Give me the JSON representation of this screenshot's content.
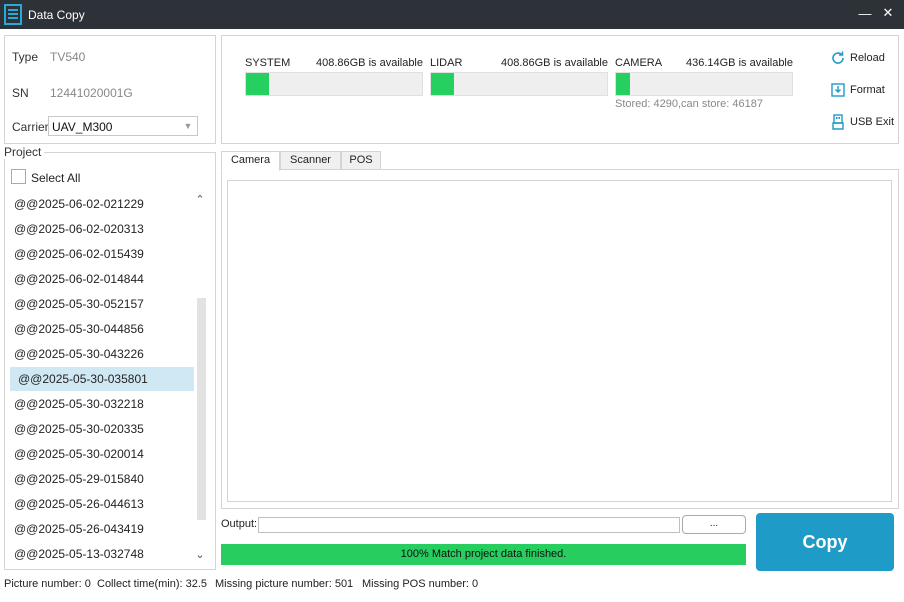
{
  "window": {
    "title": "Data Copy",
    "minimize": "—",
    "close": "✕"
  },
  "device": {
    "type_label": "Type",
    "type_value": "TV540",
    "sn_label": "SN",
    "sn_value": "12441020001G",
    "carrier_label": "Carrier",
    "carrier_value": "UAV_M300"
  },
  "project": {
    "legend": "Project",
    "select_all_label": "Select All",
    "selected_index": 7,
    "items": [
      "@@2025-06-02-021229",
      "@@2025-06-02-020313",
      "@@2025-06-02-015439",
      "@@2025-06-02-014844",
      "@@2025-05-30-052157",
      "@@2025-05-30-044856",
      "@@2025-05-30-043226",
      "@@2025-05-30-035801",
      "@@2025-05-30-032218",
      "@@2025-05-30-020335",
      "@@2025-05-30-020014",
      "@@2025-05-29-015840",
      "@@2025-05-26-044613",
      "@@2025-05-26-043419",
      "@@2025-05-13-032748"
    ]
  },
  "storage": [
    {
      "name": "SYSTEM",
      "available": "408.86GB is available",
      "used_fraction": 0.13
    },
    {
      "name": "LIDAR",
      "available": "408.86GB is available",
      "used_fraction": 0.13
    },
    {
      "name": "CAMERA",
      "available": "436.14GB is available",
      "used_fraction": 0.08
    }
  ],
  "stored_text": "Stored: 4290,can store: 46187",
  "actions": {
    "reload": "Reload",
    "format": "Format",
    "usb_exit": "USB Exit"
  },
  "tabs": [
    "Camera",
    "Scanner",
    "POS"
  ],
  "active_tab": "Camera",
  "output": {
    "label": "Output:",
    "value": "",
    "browse_label": "..."
  },
  "progress": {
    "text": "100% Match project data finished.",
    "percent": 100
  },
  "copy_label": "Copy",
  "status": {
    "picture_number": "Picture number: 0",
    "collect_time": "Collect time(min): 32.5",
    "missing_picture": "Missing picture number: 501",
    "missing_pos": "Missing POS number: 0"
  },
  "colors": {
    "titlebar": "#2d3138",
    "accent": "#1f9bc7",
    "progress": "#27cd5f",
    "selected_row": "#cfe8f3"
  }
}
